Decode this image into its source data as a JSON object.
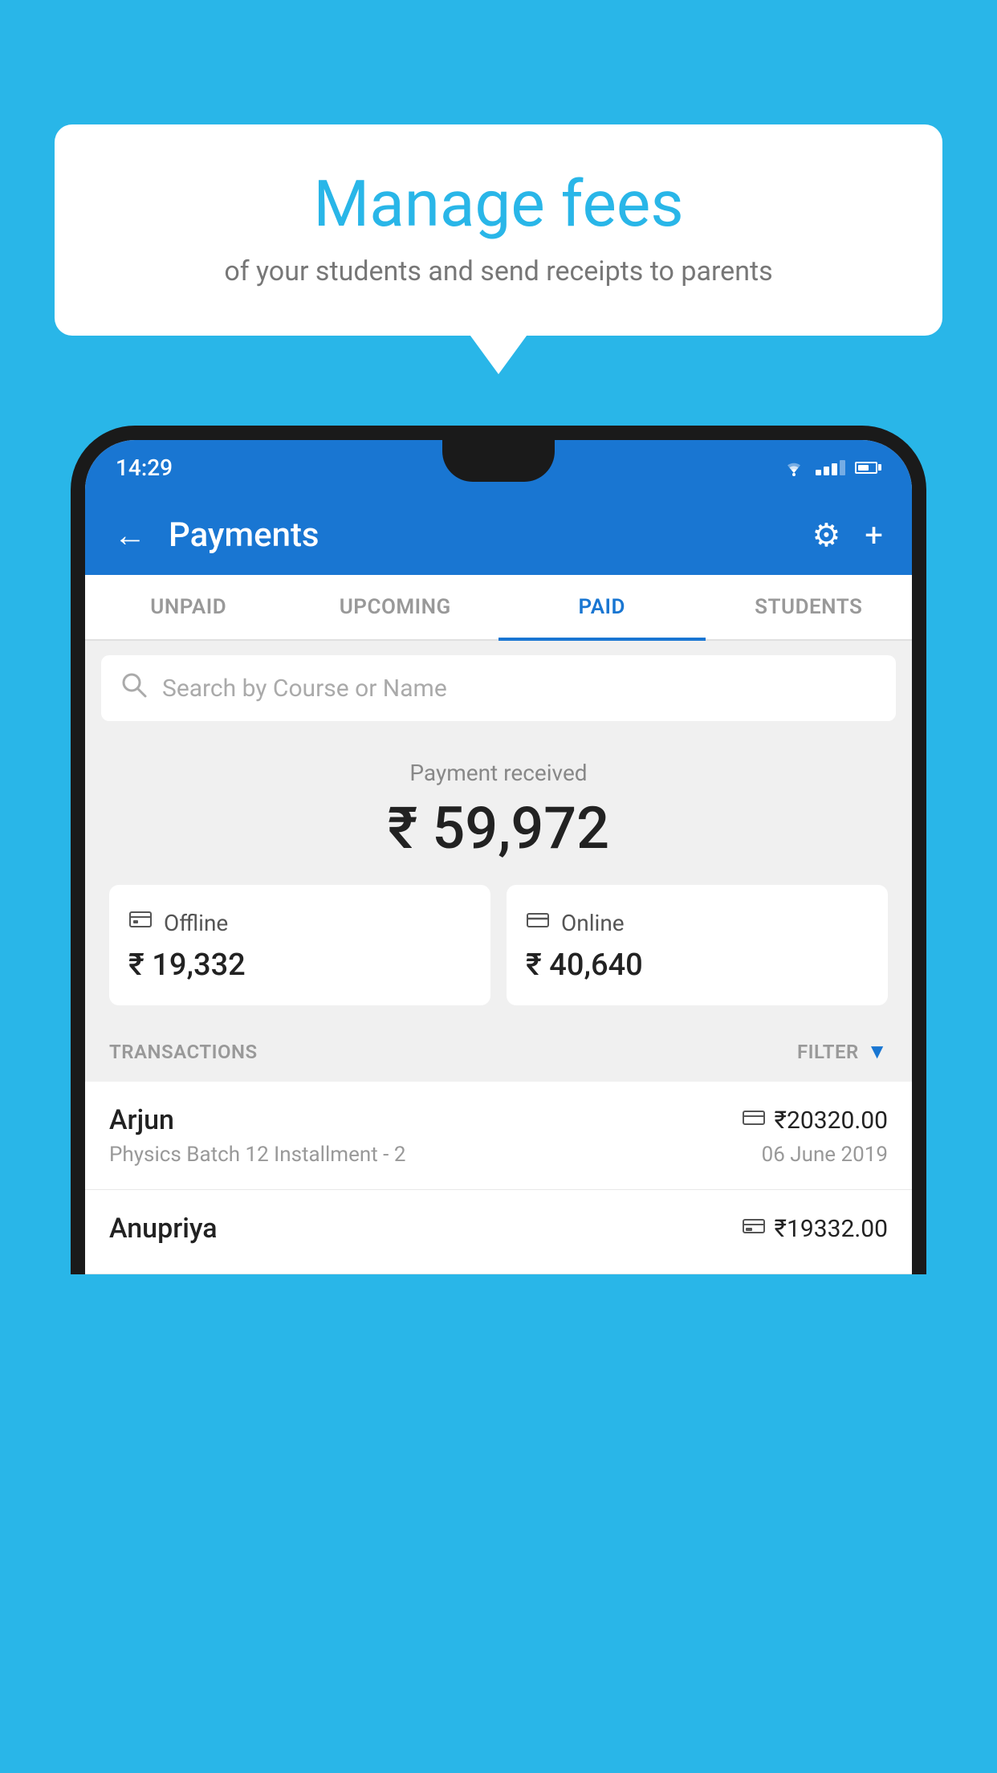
{
  "background_color": "#29B6E8",
  "speech_bubble": {
    "title": "Manage fees",
    "subtitle": "of your students and send receipts to parents"
  },
  "status_bar": {
    "time": "14:29",
    "wifi": "▼",
    "signal": "▲",
    "battery": "▐"
  },
  "app_bar": {
    "title": "Payments",
    "back_label": "←",
    "settings_label": "⚙",
    "add_label": "+"
  },
  "tabs": [
    {
      "label": "UNPAID",
      "active": false
    },
    {
      "label": "UPCOMING",
      "active": false
    },
    {
      "label": "PAID",
      "active": true
    },
    {
      "label": "STUDENTS",
      "active": false
    }
  ],
  "search": {
    "placeholder": "Search by Course or Name"
  },
  "payment_summary": {
    "label": "Payment received",
    "total_amount": "₹ 59,972",
    "offline": {
      "type": "Offline",
      "amount": "₹ 19,332"
    },
    "online": {
      "type": "Online",
      "amount": "₹ 40,640"
    }
  },
  "transactions_section": {
    "label": "TRANSACTIONS",
    "filter_label": "FILTER"
  },
  "transactions": [
    {
      "name": "Arjun",
      "description": "Physics Batch 12 Installment - 2",
      "amount": "₹20320.00",
      "date": "06 June 2019",
      "type": "online"
    },
    {
      "name": "Anupriya",
      "description": "",
      "amount": "₹19332.00",
      "date": "",
      "type": "offline"
    }
  ]
}
